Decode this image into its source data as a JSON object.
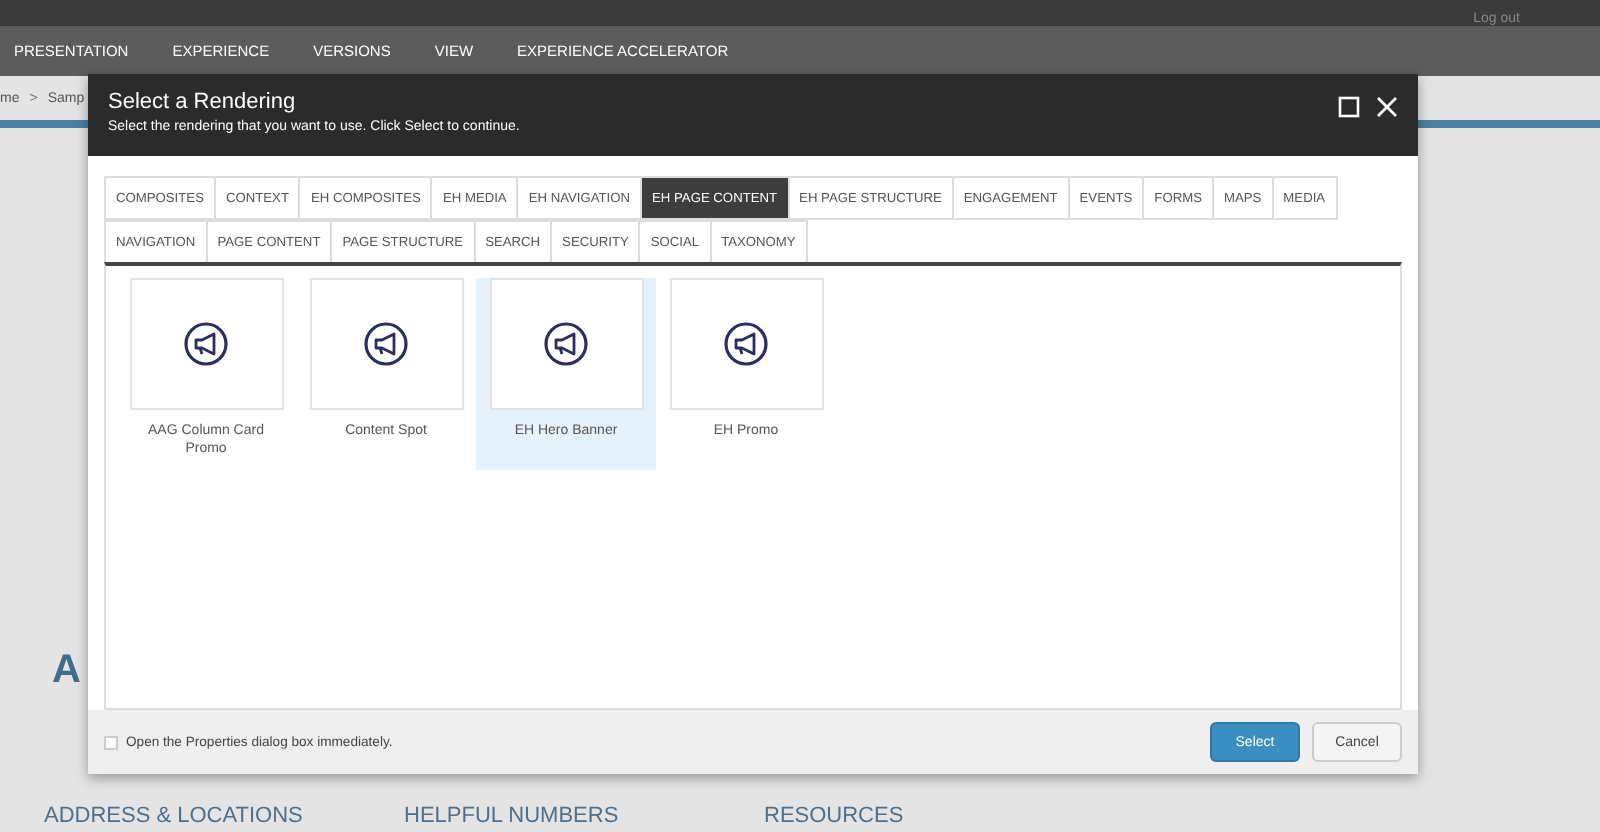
{
  "top_bar": {
    "link": "Log out"
  },
  "nav": [
    "PRESENTATION",
    "EXPERIENCE",
    "VERSIONS",
    "VIEW",
    "EXPERIENCE ACCELERATOR"
  ],
  "breadcrumb": [
    "me",
    "Samp"
  ],
  "breadcrumb_separator": ">",
  "page_headings": [
    "ADDRESS & LOCATIONS",
    "HELPFUL NUMBERS",
    "RESOURCES"
  ],
  "page_big_letter": "A",
  "dialog": {
    "title": "Select a Rendering",
    "subtitle": "Select the rendering that you want to use. Click Select to continue.",
    "tab_rows": [
      {
        "tabs": [
          {
            "label": "COMPOSITES",
            "selected": false
          },
          {
            "label": "CONTEXT",
            "selected": false
          },
          {
            "label": "EH COMPOSITES",
            "selected": false
          },
          {
            "label": "EH MEDIA",
            "selected": false
          },
          {
            "label": "EH NAVIGATION",
            "selected": false
          },
          {
            "label": "EH PAGE CONTENT",
            "selected": true
          },
          {
            "label": "EH PAGE STRUCTURE",
            "selected": false
          },
          {
            "label": "ENGAGEMENT",
            "selected": false
          },
          {
            "label": "EVENTS",
            "selected": false
          },
          {
            "label": "FORMS",
            "selected": false
          },
          {
            "label": "MAPS",
            "selected": false
          },
          {
            "label": "MEDIA",
            "selected": false
          }
        ]
      },
      {
        "tabs": [
          {
            "label": "NAVIGATION",
            "selected": false
          },
          {
            "label": "PAGE CONTENT",
            "selected": false
          },
          {
            "label": "PAGE STRUCTURE",
            "selected": false
          },
          {
            "label": "SEARCH",
            "selected": false
          },
          {
            "label": "SECURITY",
            "selected": false
          },
          {
            "label": "SOCIAL",
            "selected": false
          },
          {
            "label": "TAXONOMY",
            "selected": false
          }
        ]
      }
    ],
    "renderings": [
      {
        "label": "AAG Column Card Promo",
        "selected": false
      },
      {
        "label": "Content Spot",
        "selected": false
      },
      {
        "label": "EH Hero Banner",
        "selected": true
      },
      {
        "label": "EH Promo",
        "selected": false
      }
    ],
    "checkbox": {
      "label": "Open the Properties dialog box immediately.",
      "checked": false
    },
    "buttons": [
      {
        "label": "Select",
        "kind": "primary"
      },
      {
        "label": "Cancel",
        "kind": "secondary"
      }
    ]
  }
}
